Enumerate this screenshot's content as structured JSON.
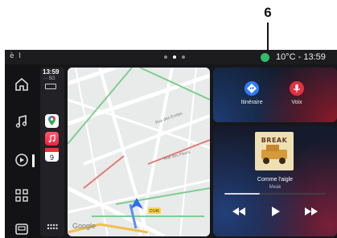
{
  "callout": {
    "number": "6"
  },
  "status_bar": {
    "left_indicators": "è ⌇",
    "temperature": "10°C",
    "separator": "-",
    "time": "13:59"
  },
  "carplay": {
    "time": "13:59",
    "network": "∙∙∙ 5G"
  },
  "map": {
    "attribution": "Google",
    "road_labels": [
      "D146"
    ]
  },
  "nav_card": {
    "itinerary_label": "Itinéraire",
    "voice_label": "Voix"
  },
  "music_card": {
    "cover_text": "BREAK",
    "song": "Comme l'aigle",
    "artist": "Meak",
    "progress": 0.35
  },
  "colors": {
    "green_indicator": "#2fbd6a",
    "itinerary_blue": "#2f7cf6",
    "voice_red": "#e1313f"
  }
}
